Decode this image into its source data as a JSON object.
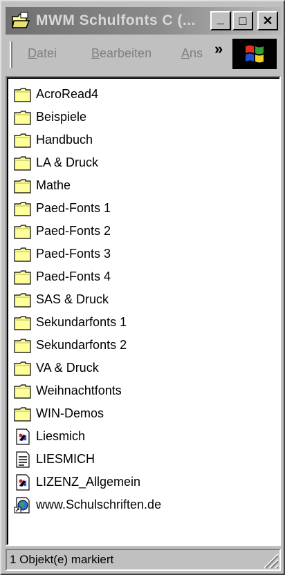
{
  "window": {
    "title": "MWM Schulfonts C (...",
    "minimize_glyph": "_",
    "maximize_glyph": "□",
    "close_glyph": "✕"
  },
  "menubar": {
    "items": [
      {
        "label": "Datei",
        "accel": "D"
      },
      {
        "label": "Bearbeiten",
        "accel": "B"
      },
      {
        "label": "Ans",
        "accel": "A"
      }
    ],
    "overflow_glyph": "»",
    "logo_icon": "windows-flag-icon"
  },
  "files": [
    {
      "name": "AcroRead4",
      "icon": "folder-icon"
    },
    {
      "name": "Beispiele",
      "icon": "folder-icon"
    },
    {
      "name": "Handbuch",
      "icon": "folder-icon"
    },
    {
      "name": "LA & Druck",
      "icon": "folder-icon"
    },
    {
      "name": "Mathe",
      "icon": "folder-icon"
    },
    {
      "name": "Paed-Fonts 1",
      "icon": "folder-icon"
    },
    {
      "name": "Paed-Fonts 2",
      "icon": "folder-icon"
    },
    {
      "name": "Paed-Fonts 3",
      "icon": "folder-icon"
    },
    {
      "name": "Paed-Fonts 4",
      "icon": "folder-icon"
    },
    {
      "name": "SAS & Druck",
      "icon": "folder-icon"
    },
    {
      "name": "Sekundarfonts 1",
      "icon": "folder-icon"
    },
    {
      "name": "Sekundarfonts 2",
      "icon": "folder-icon"
    },
    {
      "name": "VA & Druck",
      "icon": "folder-icon"
    },
    {
      "name": "Weihnachtfonts",
      "icon": "folder-icon"
    },
    {
      "name": "WIN-Demos",
      "icon": "folder-icon"
    },
    {
      "name": "Liesmich",
      "icon": "wordpad-document-icon"
    },
    {
      "name": "LIESMICH",
      "icon": "text-document-icon"
    },
    {
      "name": "LIZENZ_Allgemein",
      "icon": "wordpad-document-icon"
    },
    {
      "name": "www.Schulschriften.de",
      "icon": "internet-shortcut-icon"
    }
  ],
  "statusbar": {
    "text": "1 Objekt(e) markiert"
  },
  "colors": {
    "face": "#c0c0c0",
    "folder": "#ffff99",
    "title_gradient_start": "#707070"
  }
}
